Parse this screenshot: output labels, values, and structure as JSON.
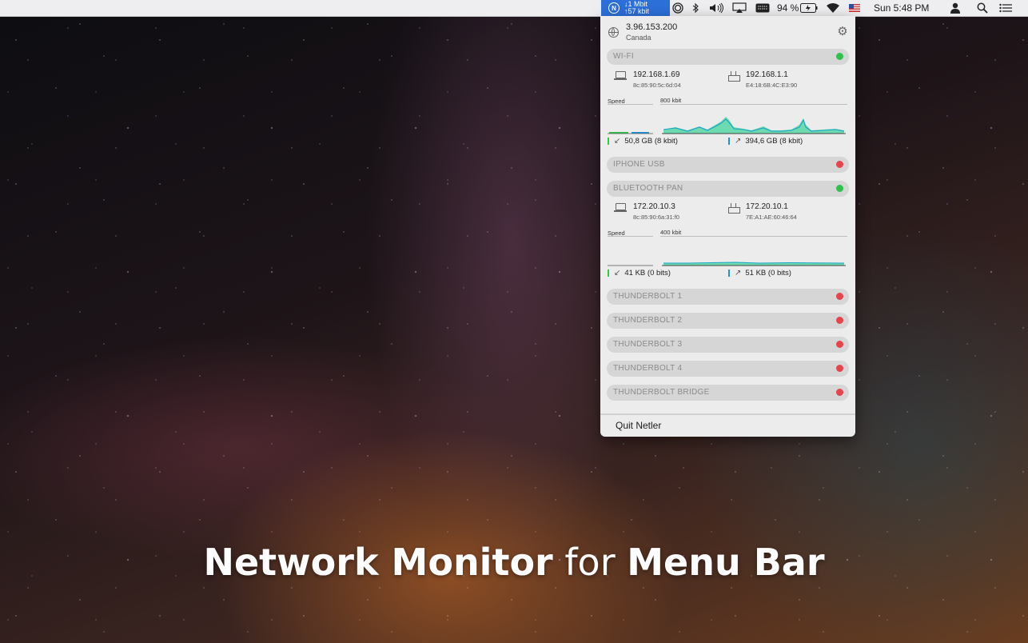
{
  "menubar": {
    "netler_down": "↓1 Mbit",
    "netler_up": "↑57 kbit",
    "battery_percent": "94 %",
    "clock": "Sun 5:48 PM"
  },
  "panel": {
    "public_ip": "3.96.153.200",
    "country": "Canada",
    "interfaces": [
      {
        "name": "WI-FI",
        "status": "connected",
        "local_ip": "192.168.1.69",
        "local_mac": "8c:85:90:5c:6d:04",
        "router_ip": "192.168.1.1",
        "router_mac": "E4:18:6B:4C:E3:90",
        "speed_label": "Speed",
        "speed_scale": "800 kbit",
        "download": "50,8 GB (8 kbit)",
        "upload": "394,6 GB (8 kbit)"
      },
      {
        "name": "IPHONE USB",
        "status": "disconnected"
      },
      {
        "name": "BLUETOOTH PAN",
        "status": "connected",
        "local_ip": "172.20.10.3",
        "local_mac": "8c:85:90:6a:31:f0",
        "router_ip": "172.20.10.1",
        "router_mac": "7E:A1:AE:60:46:64",
        "speed_label": "Speed",
        "speed_scale": "400 kbit",
        "download": "41 KB (0 bits)",
        "upload": "51 KB (0 bits)"
      },
      {
        "name": "THUNDERBOLT 1",
        "status": "disconnected"
      },
      {
        "name": "THUNDERBOLT 2",
        "status": "disconnected"
      },
      {
        "name": "THUNDERBOLT 3",
        "status": "disconnected"
      },
      {
        "name": "THUNDERBOLT 4",
        "status": "disconnected"
      },
      {
        "name": "THUNDERBOLT BRIDGE",
        "status": "disconnected"
      }
    ],
    "quit_label": "Quit Netler"
  },
  "headline": {
    "part1": "Network Monitor",
    "part2": "for",
    "part3": "Menu Bar"
  },
  "colors": {
    "connected": "#2fc24a",
    "disconnected": "#e8424a",
    "menubar_highlight": "#2c6fd8",
    "graph_fill": "#5fd8a8",
    "graph_line": "#1aa3c8"
  },
  "icons": [
    "netler-icon",
    "screen-record-icon",
    "bluetooth-icon",
    "volume-icon",
    "airplay-icon",
    "keyboard-icon",
    "battery-icon",
    "wifi-icon",
    "flag-icon",
    "user-icon",
    "search-icon",
    "list-icon",
    "globe-icon",
    "gear-icon",
    "laptop-icon",
    "router-icon",
    "download-arrow-icon",
    "upload-arrow-icon"
  ]
}
